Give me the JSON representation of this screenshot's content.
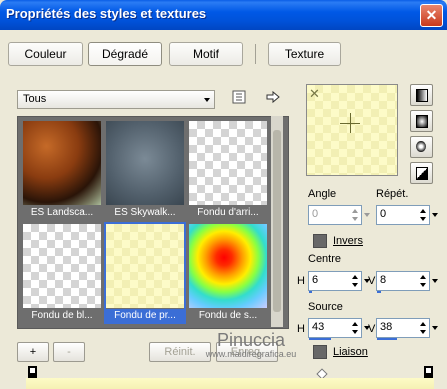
{
  "window": {
    "title": "Propriétés des styles et textures",
    "close_glyph": "✕"
  },
  "tabs": [
    {
      "label": "Couleur",
      "active": false
    },
    {
      "label": "Dégradé",
      "active": true
    },
    {
      "label": "Motif",
      "active": false
    },
    {
      "label": "Texture",
      "active": false
    }
  ],
  "category": {
    "value": "Tous"
  },
  "gallery": {
    "items": [
      {
        "caption": "ES Landsca...",
        "icon": "dark-sphere-gradient",
        "selected": false
      },
      {
        "caption": "ES Skywalk...",
        "icon": "blue-grey-gradient",
        "selected": false
      },
      {
        "caption": "Fondu d'arri...",
        "icon": "transparent-fade",
        "selected": false
      },
      {
        "caption": "Fondu de bl...",
        "icon": "grey-transparent-fade",
        "selected": false
      },
      {
        "caption": "Fondu de pr...",
        "icon": "yellow-fade",
        "selected": true
      },
      {
        "caption": "Fondu de s...",
        "icon": "spectrum-radial",
        "selected": false
      }
    ]
  },
  "controls": {
    "angle": {
      "label": "Angle",
      "value": "0",
      "disabled": true
    },
    "repeat": {
      "label": "Répét.",
      "value": "0"
    },
    "invert": {
      "label": "Invers"
    },
    "center": {
      "label": "Centre",
      "h_label": "H",
      "h_value": "6",
      "v_label": "V",
      "v_value": "8",
      "h_fraction": 0.06,
      "v_fraction": 0.08
    },
    "source": {
      "label": "Source",
      "h_label": "H",
      "h_value": "43",
      "v_label": "V",
      "v_value": "38",
      "h_fraction": 0.43,
      "v_fraction": 0.38
    },
    "link": {
      "label": "Liaison"
    }
  },
  "buttons": {
    "add": "+",
    "remove": "-",
    "reset": "Réinit.",
    "save": "Enreg."
  },
  "watermark": {
    "name": "Pinuccia",
    "url": "www.maidiregrafica.eu"
  },
  "colors": {
    "accent": "#3b6ed6",
    "titlebar": "#0058e6",
    "gradient_start": "#fdfbc6",
    "gradient_end": "#f5f1b4"
  }
}
